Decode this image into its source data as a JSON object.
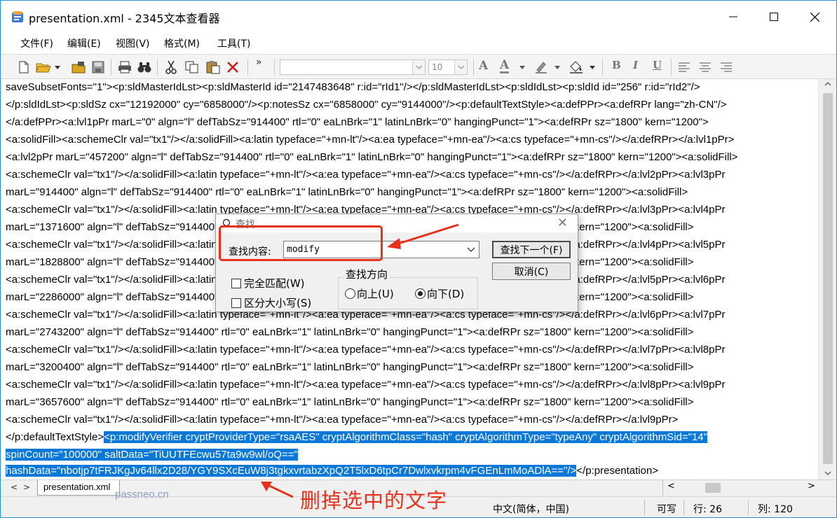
{
  "window": {
    "title": "presentation.xml - 2345文本查看器",
    "accent": "#2b8fd6"
  },
  "menu": [
    "文件(F)",
    "编辑(E)",
    "视图(V)",
    "格式(M)",
    "工具(T)"
  ],
  "toolbar": {
    "overflow_glyph": "»",
    "font_name": "",
    "font_size": "10",
    "format_letters": [
      "A",
      "A",
      "B",
      "I",
      "U"
    ]
  },
  "editor": {
    "lines": [
      "saveSubsetFonts=\"1\"><p:sldMasterIdLst><p:sldMasterId id=\"2147483648\" r:id=\"rId1\"/></p:sldMasterIdLst><p:sldIdLst><p:sldId id=\"256\" r:id=\"rId2\"/>",
      "</p:sldIdLst><p:sldSz cx=\"12192000\" cy=\"6858000\"/><p:notesSz cx=\"6858000\" cy=\"9144000\"/><p:defaultTextStyle><a:defPPr><a:defRPr lang=\"zh-CN\"/>",
      "</a:defPPr><a:lvl1pPr marL=\"0\" algn=\"l\" defTabSz=\"914400\" rtl=\"0\" eaLnBrk=\"1\" latinLnBrk=\"0\" hangingPunct=\"1\"><a:defRPr sz=\"1800\" kern=\"1200\">",
      "<a:solidFill><a:schemeClr val=\"tx1\"/></a:solidFill><a:latin typeface=\"+mn-lt\"/><a:ea typeface=\"+mn-ea\"/><a:cs typeface=\"+mn-cs\"/></a:defRPr></a:lvl1pPr>",
      "<a:lvl2pPr marL=\"457200\" algn=\"l\" defTabSz=\"914400\" rtl=\"0\" eaLnBrk=\"1\" latinLnBrk=\"0\" hangingPunct=\"1\"><a:defRPr sz=\"1800\" kern=\"1200\"><a:solidFill>",
      "<a:schemeClr val=\"tx1\"/></a:solidFill><a:latin typeface=\"+mn-lt\"/><a:ea typeface=\"+mn-ea\"/><a:cs typeface=\"+mn-cs\"/></a:defRPr></a:lvl2pPr><a:lvl3pPr",
      "marL=\"914400\" algn=\"l\" defTabSz=\"914400\" rtl=\"0\" eaLnBrk=\"1\" latinLnBrk=\"0\" hangingPunct=\"1\"><a:defRPr sz=\"1800\" kern=\"1200\"><a:solidFill>",
      "<a:schemeClr val=\"tx1\"/></a:solidFill><a:latin typeface=\"+mn-lt\"/><a:ea typeface=\"+mn-ea\"/><a:cs typeface=\"+mn-cs\"/></a:defRPr></a:lvl3pPr><a:lvl4pPr",
      "marL=\"1371600\" algn=\"l\" defTabSz=\"914400\" rtl=\"0\" eaLnBrk=\"1\" latinLnBrk=\"0\" hangingPunct=\"1\"><a:defRPr sz=\"1800\" kern=\"1200\"><a:solidFill>",
      "<a:schemeClr val=\"tx1\"/></a:solidFill><a:latin typeface=\"+mn-lt\"/><a:ea typeface=\"+mn-ea\"/><a:cs typeface=\"+mn-cs\"/></a:defRPr></a:lvl4pPr><a:lvl5pPr",
      "marL=\"1828800\" algn=\"l\" defTabSz=\"914400\" rtl=\"0\" eaLnBrk=\"1\" latinLnBrk=\"0\" hangingPunct=\"1\"><a:defRPr sz=\"1800\" kern=\"1200\"><a:solidFill>",
      "<a:schemeClr val=\"tx1\"/></a:solidFill><a:latin typeface=\"+mn-lt\"/><a:ea typeface=\"+mn-ea\"/><a:cs typeface=\"+mn-cs\"/></a:defRPr></a:lvl5pPr><a:lvl6pPr",
      "marL=\"2286000\" algn=\"l\" defTabSz=\"914400\" rtl=\"0\" eaLnBrk=\"1\" latinLnBrk=\"0\" hangingPunct=\"1\"><a:defRPr sz=\"1800\" kern=\"1200\"><a:solidFill>",
      "<a:schemeClr val=\"tx1\"/></a:solidFill><a:latin typeface=\"+mn-lt\"/><a:ea typeface=\"+mn-ea\"/><a:cs typeface=\"+mn-cs\"/></a:defRPr></a:lvl6pPr><a:lvl7pPr",
      "marL=\"2743200\" algn=\"l\" defTabSz=\"914400\" rtl=\"0\" eaLnBrk=\"1\" latinLnBrk=\"0\" hangingPunct=\"1\"><a:defRPr sz=\"1800\" kern=\"1200\"><a:solidFill>",
      "<a:schemeClr val=\"tx1\"/></a:solidFill><a:latin typeface=\"+mn-lt\"/><a:ea typeface=\"+mn-ea\"/><a:cs typeface=\"+mn-cs\"/></a:defRPr></a:lvl7pPr><a:lvl8pPr",
      "marL=\"3200400\" algn=\"l\" defTabSz=\"914400\" rtl=\"0\" eaLnBrk=\"1\" latinLnBrk=\"0\" hangingPunct=\"1\"><a:defRPr sz=\"1800\" kern=\"1200\"><a:solidFill>",
      "<a:schemeClr val=\"tx1\"/></a:solidFill><a:latin typeface=\"+mn-lt\"/><a:ea typeface=\"+mn-ea\"/><a:cs typeface=\"+mn-cs\"/></a:defRPr></a:lvl8pPr><a:lvl9pPr",
      "marL=\"3657600\" algn=\"l\" defTabSz=\"914400\" rtl=\"0\" eaLnBrk=\"1\" latinLnBrk=\"0\" hangingPunct=\"1\"><a:defRPr sz=\"1800\" kern=\"1200\"><a:solidFill>",
      "<a:schemeClr val=\"tx1\"/></a:solidFill><a:latin typeface=\"+mn-lt\"/><a:ea typeface=\"+mn-ea\"/><a:cs typeface=\"+mn-cs\"/></a:defRPr></a:lvl9pPr>"
    ],
    "line21_plain": "</p:defaultTextStyle>",
    "line21_selected": "<p:modifyVerifier cryptProviderType=\"rsaAES\" cryptAlgorithmClass=\"hash\" cryptAlgorithmType=\"typeAny\" cryptAlgorithmSid=\"14\"",
    "line22_selected": "spinCount=\"100000\" saltData=\"TiUUTFEcwu57ta9w9wl/oQ==\"",
    "line23_selected": "hashData=\"nbotjp7tFRJKgJv64llx2D28/YGY9SXcEuW8j3tgkxvrtabzXpQ2T5lxD6tpCr7Dwlxvkrpm4vFGEnLmMoADlA==\"/>",
    "line23_plain": "</p:presentation>",
    "selection_color": "#0a78d7"
  },
  "find_dialog": {
    "title": "查找",
    "label": "查找内容:",
    "value": "modify",
    "find_next": "查找下一个(F)",
    "cancel": "取消(C)",
    "match_whole": "完全匹配(W)",
    "match_case": "区分大小写(S)",
    "direction_title": "查找方向",
    "dir_up": "向上(U)",
    "dir_down": "向下(D)",
    "selected_direction": "down"
  },
  "tabs": {
    "file_tab": "presentation.xml"
  },
  "statusbar": {
    "encoding": "中文(简体，中国)",
    "mode": "可写",
    "row": "行: 26",
    "col": "列: 120"
  },
  "overlay": {
    "watermark": "passneo.cn",
    "annotation": "删掉选中的文字",
    "annotation_color": "#e8311c"
  }
}
